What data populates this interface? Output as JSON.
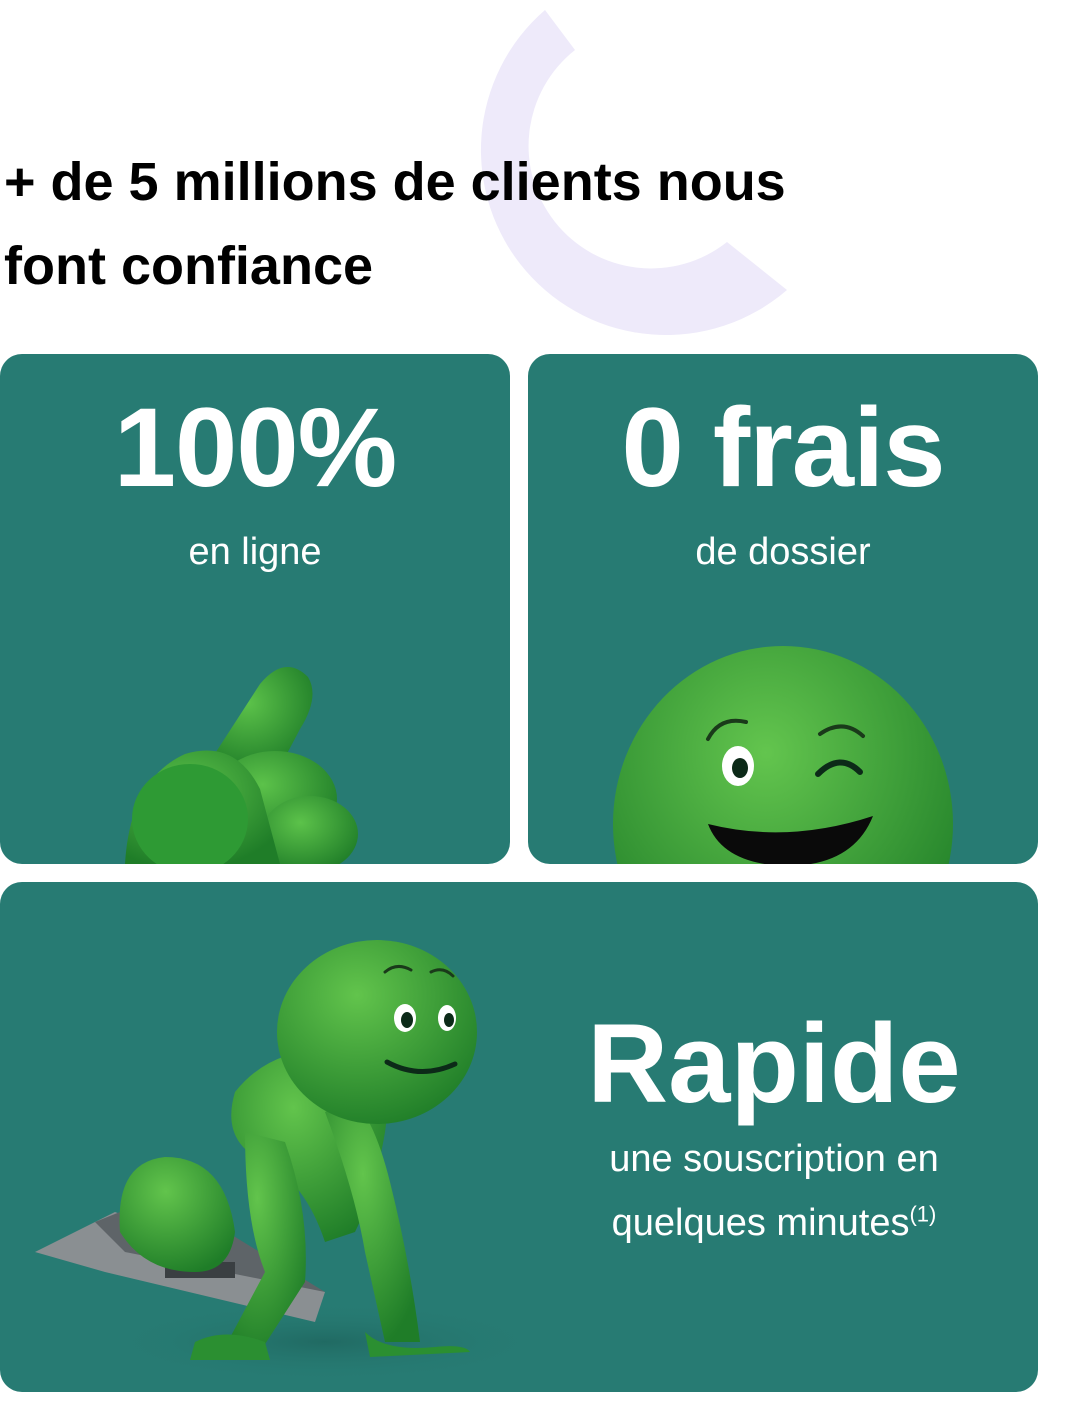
{
  "headline": {
    "line1": "+ de 5 millions de clients nous",
    "line2": "font confiance"
  },
  "colors": {
    "card_bg": "#277b73",
    "mascot_green": "#3aa33a",
    "deco_arc": "#eeeafa",
    "text_dark": "#000000",
    "text_light": "#ffffff"
  },
  "cards": [
    {
      "title": "100%",
      "subtitle": "en ligne",
      "illustration": "mascot-pointing-finger"
    },
    {
      "title": "0 frais",
      "subtitle": "de dossier",
      "illustration": "mascot-winking-face"
    },
    {
      "title": "Rapide",
      "subtitle_line1": "une souscription en",
      "subtitle_line2": "quelques minutes",
      "footnote": "(1)",
      "illustration": "mascot-sprinter-starting-block"
    }
  ]
}
